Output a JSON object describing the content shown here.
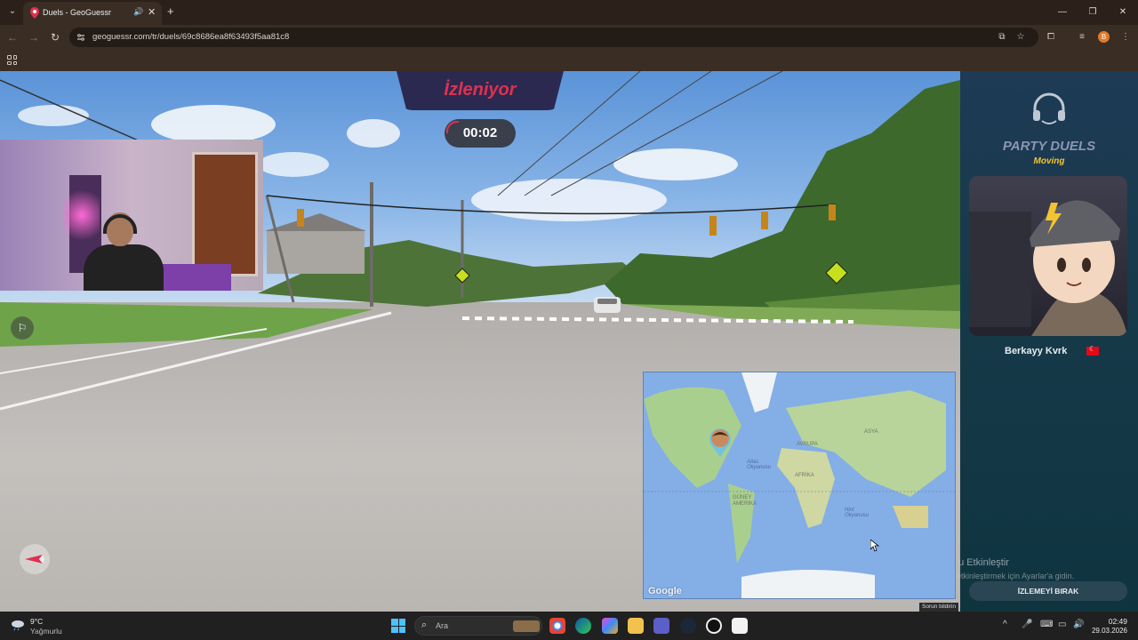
{
  "browser": {
    "tab_title": "Duels - GeoGuessr",
    "url": "geoguessr.com/tr/duels/69c8686ea8f63493f5aa81c8",
    "window_controls": [
      "—",
      "❐",
      "✕"
    ]
  },
  "game": {
    "status_banner": "İzleniyor",
    "timer": "00:02",
    "map": {
      "continents": [
        "AVRUPA",
        "ASYA",
        "AFRİKA",
        "GÜNEY AMERİKA"
      ],
      "oceans": [
        "Atlas Okyanusu",
        "Hint Okyanusu"
      ],
      "logo": "Google",
      "report_link": "Sorun bildirin"
    }
  },
  "side_panel": {
    "title": "PARTY DUELS",
    "subtitle": "Moving",
    "player_name": "Berkayy Kvrk",
    "player_flag": "turkey-flag",
    "stop_button": "İZLEMEYİ BIRAK"
  },
  "windows_activation": {
    "line1": "'u Etkinleştir",
    "line2": "etkinleştirmek için Ayarlar'a gidin."
  },
  "taskbar": {
    "weather_temp": "9°C",
    "weather_desc": "Yağmurlu",
    "search_placeholder": "Ara",
    "time": "02:49",
    "date": "29.03.2026"
  },
  "colors": {
    "banner_bg": "#2c2950",
    "banner_text": "#e0304f",
    "accent_yellow": "#f4c430",
    "panel_bg": "#173a4a"
  }
}
